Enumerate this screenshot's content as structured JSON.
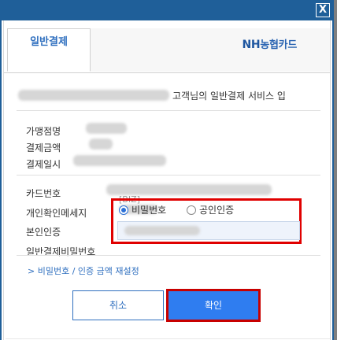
{
  "window": {
    "close_label": "X"
  },
  "tabs": {
    "active_label": "일반결제"
  },
  "brand": {
    "nh": "NH",
    "card": "농협카드"
  },
  "greeting": {
    "text": "고객님의 일반결제 서비스 입"
  },
  "fields": {
    "merchant_label": "가맹점명",
    "amount_label": "결제금액",
    "datetime_label": "결제일시",
    "card_number_label": "카드번호",
    "card_suffix": "[BIZ]",
    "personal_msg_label": "개인확인메세지",
    "auth_label": "본인인증",
    "password_label": "일반결제비밀번호"
  },
  "auth_options": {
    "password": "비밀번호",
    "certificate": "공인인증",
    "selected": "password"
  },
  "link": {
    "reset": "비밀번호 / 인증 금액 재설정",
    "chevron": ">"
  },
  "buttons": {
    "cancel": "취소",
    "confirm": "확인"
  },
  "colors": {
    "titlebar": "#1f5f99",
    "accent": "#2f6fbf",
    "confirm_bg": "#2f7df0",
    "highlight": "#e00000"
  }
}
